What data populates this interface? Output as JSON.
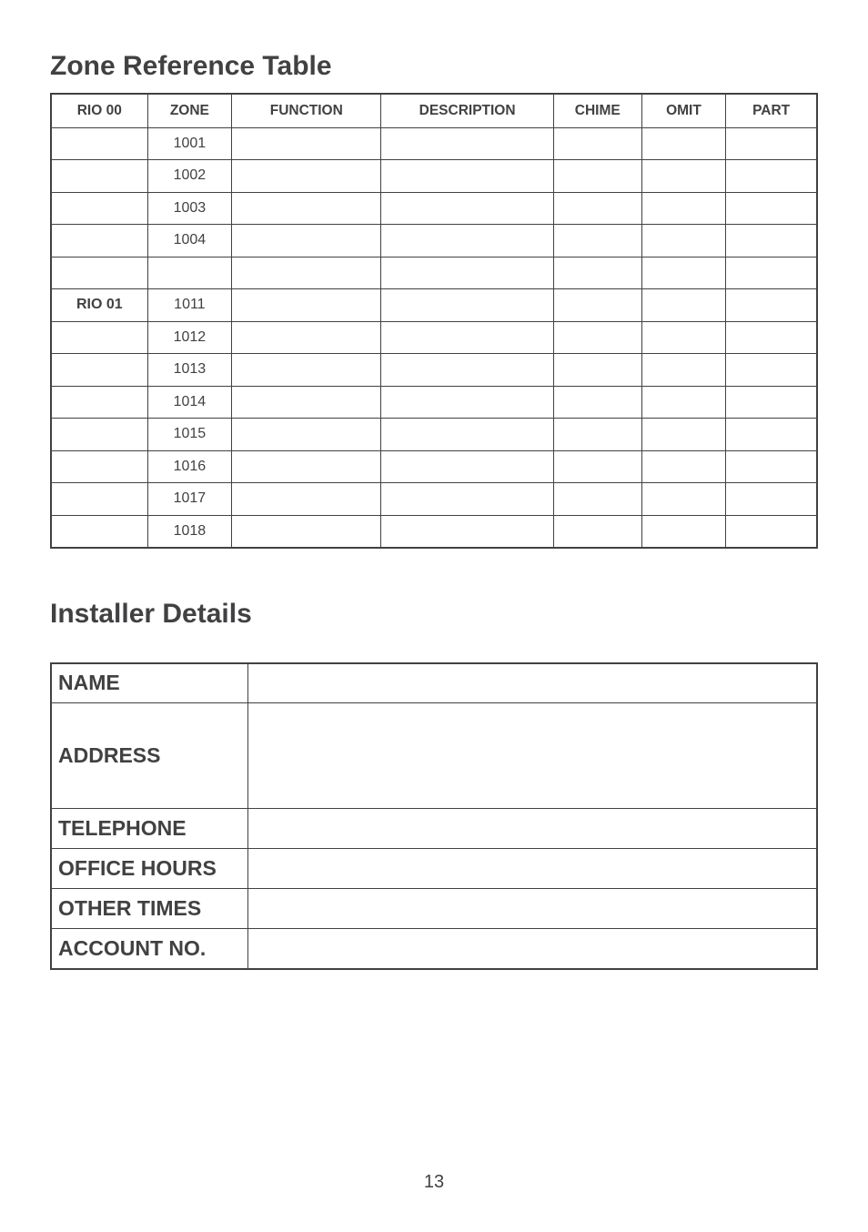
{
  "titles": {
    "zone": "Zone Reference Table",
    "installer": "Installer Details"
  },
  "zone_table": {
    "headers": {
      "rio": "RIO 00",
      "zone": "ZONE",
      "function": "FUNCTION",
      "description": "DESCRIPTION",
      "chime": "CHIME",
      "omit": "OMIT",
      "part": "PART"
    },
    "rows": [
      {
        "rio": "",
        "zone": "1001",
        "function": "",
        "description": "",
        "chime": "",
        "omit": "",
        "part": ""
      },
      {
        "rio": "",
        "zone": "1002",
        "function": "",
        "description": "",
        "chime": "",
        "omit": "",
        "part": ""
      },
      {
        "rio": "",
        "zone": "1003",
        "function": "",
        "description": "",
        "chime": "",
        "omit": "",
        "part": ""
      },
      {
        "rio": "",
        "zone": "1004",
        "function": "",
        "description": "",
        "chime": "",
        "omit": "",
        "part": ""
      },
      {
        "rio": "",
        "zone": "",
        "function": "",
        "description": "",
        "chime": "",
        "omit": "",
        "part": ""
      },
      {
        "rio": "RIO 01",
        "zone": "1011",
        "function": "",
        "description": "",
        "chime": "",
        "omit": "",
        "part": ""
      },
      {
        "rio": "",
        "zone": "1012",
        "function": "",
        "description": "",
        "chime": "",
        "omit": "",
        "part": ""
      },
      {
        "rio": "",
        "zone": "1013",
        "function": "",
        "description": "",
        "chime": "",
        "omit": "",
        "part": ""
      },
      {
        "rio": "",
        "zone": "1014",
        "function": "",
        "description": "",
        "chime": "",
        "omit": "",
        "part": ""
      },
      {
        "rio": "",
        "zone": "1015",
        "function": "",
        "description": "",
        "chime": "",
        "omit": "",
        "part": ""
      },
      {
        "rio": "",
        "zone": "1016",
        "function": "",
        "description": "",
        "chime": "",
        "omit": "",
        "part": ""
      },
      {
        "rio": "",
        "zone": "1017",
        "function": "",
        "description": "",
        "chime": "",
        "omit": "",
        "part": ""
      },
      {
        "rio": "",
        "zone": "1018",
        "function": "",
        "description": "",
        "chime": "",
        "omit": "",
        "part": ""
      }
    ]
  },
  "installer_table": {
    "rows": [
      {
        "label": "NAME",
        "value": "",
        "cls": ""
      },
      {
        "label": "ADDRESS",
        "value": "",
        "cls": "addr-row"
      },
      {
        "label": "TELEPHONE",
        "value": "",
        "cls": ""
      },
      {
        "label": "OFFICE HOURS",
        "value": "",
        "cls": ""
      },
      {
        "label": "OTHER TIMES",
        "value": "",
        "cls": ""
      },
      {
        "label": "ACCOUNT NO.",
        "value": "",
        "cls": ""
      }
    ]
  },
  "page_number": "13"
}
